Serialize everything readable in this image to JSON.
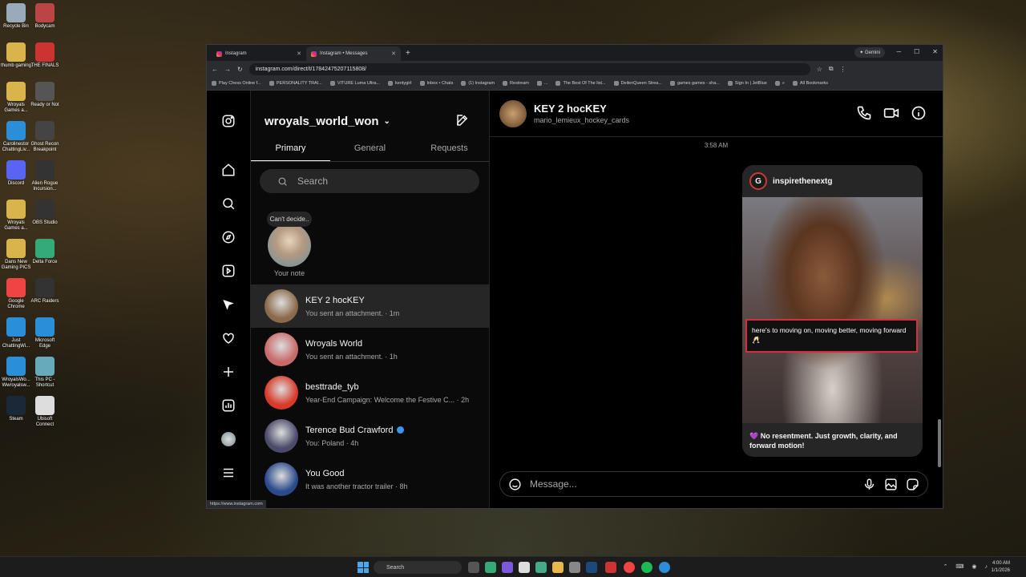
{
  "desktop": {
    "icons": [
      {
        "label": "Recycle Bin",
        "color": "#9ab"
      },
      {
        "label": "Bodycam",
        "color": "#b44"
      },
      {
        "label": "thumb gaming",
        "color": "#d9b44a"
      },
      {
        "label": "THE FINALS",
        "color": "#c33"
      },
      {
        "label": "Wroyals Games a...",
        "color": "#d9b44a"
      },
      {
        "label": "Ready or Not",
        "color": "#555"
      },
      {
        "label": "Carolinestor ChattingLiv...",
        "color": "#2a8fd8"
      },
      {
        "label": "Ghost Recon Breakpoint",
        "color": "#444"
      },
      {
        "label": "Discord",
        "color": "#5865f2"
      },
      {
        "label": "Alien Rogue Incursion...",
        "color": "#333"
      },
      {
        "label": "Wroyals Games a...",
        "color": "#d9b44a"
      },
      {
        "label": "OBS Studio",
        "color": "#333"
      },
      {
        "label": "Dans New Gaming PICS",
        "color": "#d9b44a"
      },
      {
        "label": "Delta Force",
        "color": "#3a7"
      },
      {
        "label": "Google Chrome",
        "color": "#e44"
      },
      {
        "label": "ARC Raiders",
        "color": "#333"
      },
      {
        "label": "Just ChattingWi...",
        "color": "#2a8fd8"
      },
      {
        "label": "Microsoft Edge",
        "color": "#2a8fd8"
      },
      {
        "label": "WroyalsWo... Wwroyalsw...",
        "color": "#2a8fd8"
      },
      {
        "label": "This PC - Shortcut",
        "color": "#6ab"
      },
      {
        "label": "Steam",
        "color": "#1b2838"
      },
      {
        "label": "Ubisoft Connect",
        "color": "#ddd"
      }
    ]
  },
  "browser": {
    "tabs": [
      {
        "label": "Instagram",
        "active": false
      },
      {
        "label": "Instagram • Messages",
        "active": true
      }
    ],
    "new_tab": "+",
    "gemini": "Gemini",
    "url": "instagram.com/direct/t/17842475207115808/",
    "bookmarks": [
      "Play Chess Online f...",
      "PERSONALITY TRAI...",
      "VITURE Luma Ultra...",
      "kentygirl",
      "Inbox • Chats",
      "(1) Instagram",
      "Restream",
      "...",
      "The Best Of The list...",
      "DeilenQueen Strea...",
      "games games - sha...",
      "Sign In | JetBlue",
      "»",
      "All Bookmarks"
    ],
    "status_url": "https://www.instagram.com"
  },
  "inbox": {
    "username": "wroyals_world_won",
    "subtabs": [
      "Primary",
      "General",
      "Requests"
    ],
    "search_placeholder": "Search",
    "note": {
      "bubble": "Can't decide..",
      "label": "Your note"
    },
    "conversations": [
      {
        "name": "KEY 2 hocKEY",
        "preview": "You sent an attachment. · 1m",
        "active": true,
        "verified": false,
        "color": "#8a6a4a"
      },
      {
        "name": "Wroyals World",
        "preview": "You sent an attachment. · 1h",
        "active": false,
        "verified": false,
        "color": "#c86a6a"
      },
      {
        "name": "besttrade_tyb",
        "preview": "Year-End Campaign: Welcome the Festive C...  · 2h",
        "active": false,
        "verified": false,
        "color": "#d83a2a"
      },
      {
        "name": "Terence Bud Crawford",
        "preview": "You: Poland · 4h",
        "active": false,
        "verified": true,
        "color": "#4a4a6a"
      },
      {
        "name": "You Good",
        "preview": "It was another tractor trailer · 8h",
        "active": false,
        "verified": false,
        "color": "#2a4a8a"
      }
    ]
  },
  "thread": {
    "name": "KEY 2 hocKEY",
    "username": "mario_lemieux_hockey_cards",
    "timestamp": "3:58 AM",
    "card": {
      "account": "inspirethenextg",
      "logo_letter": "G",
      "overlay_caption": "here's to moving on, moving better, moving forward 🥂",
      "text": "💜 No resentment. Just growth, clarity, and forward motion!"
    },
    "composer_placeholder": "Message..."
  },
  "taskbar": {
    "search": "Search",
    "time": "4:00 AM",
    "date": "1/1/2026"
  }
}
